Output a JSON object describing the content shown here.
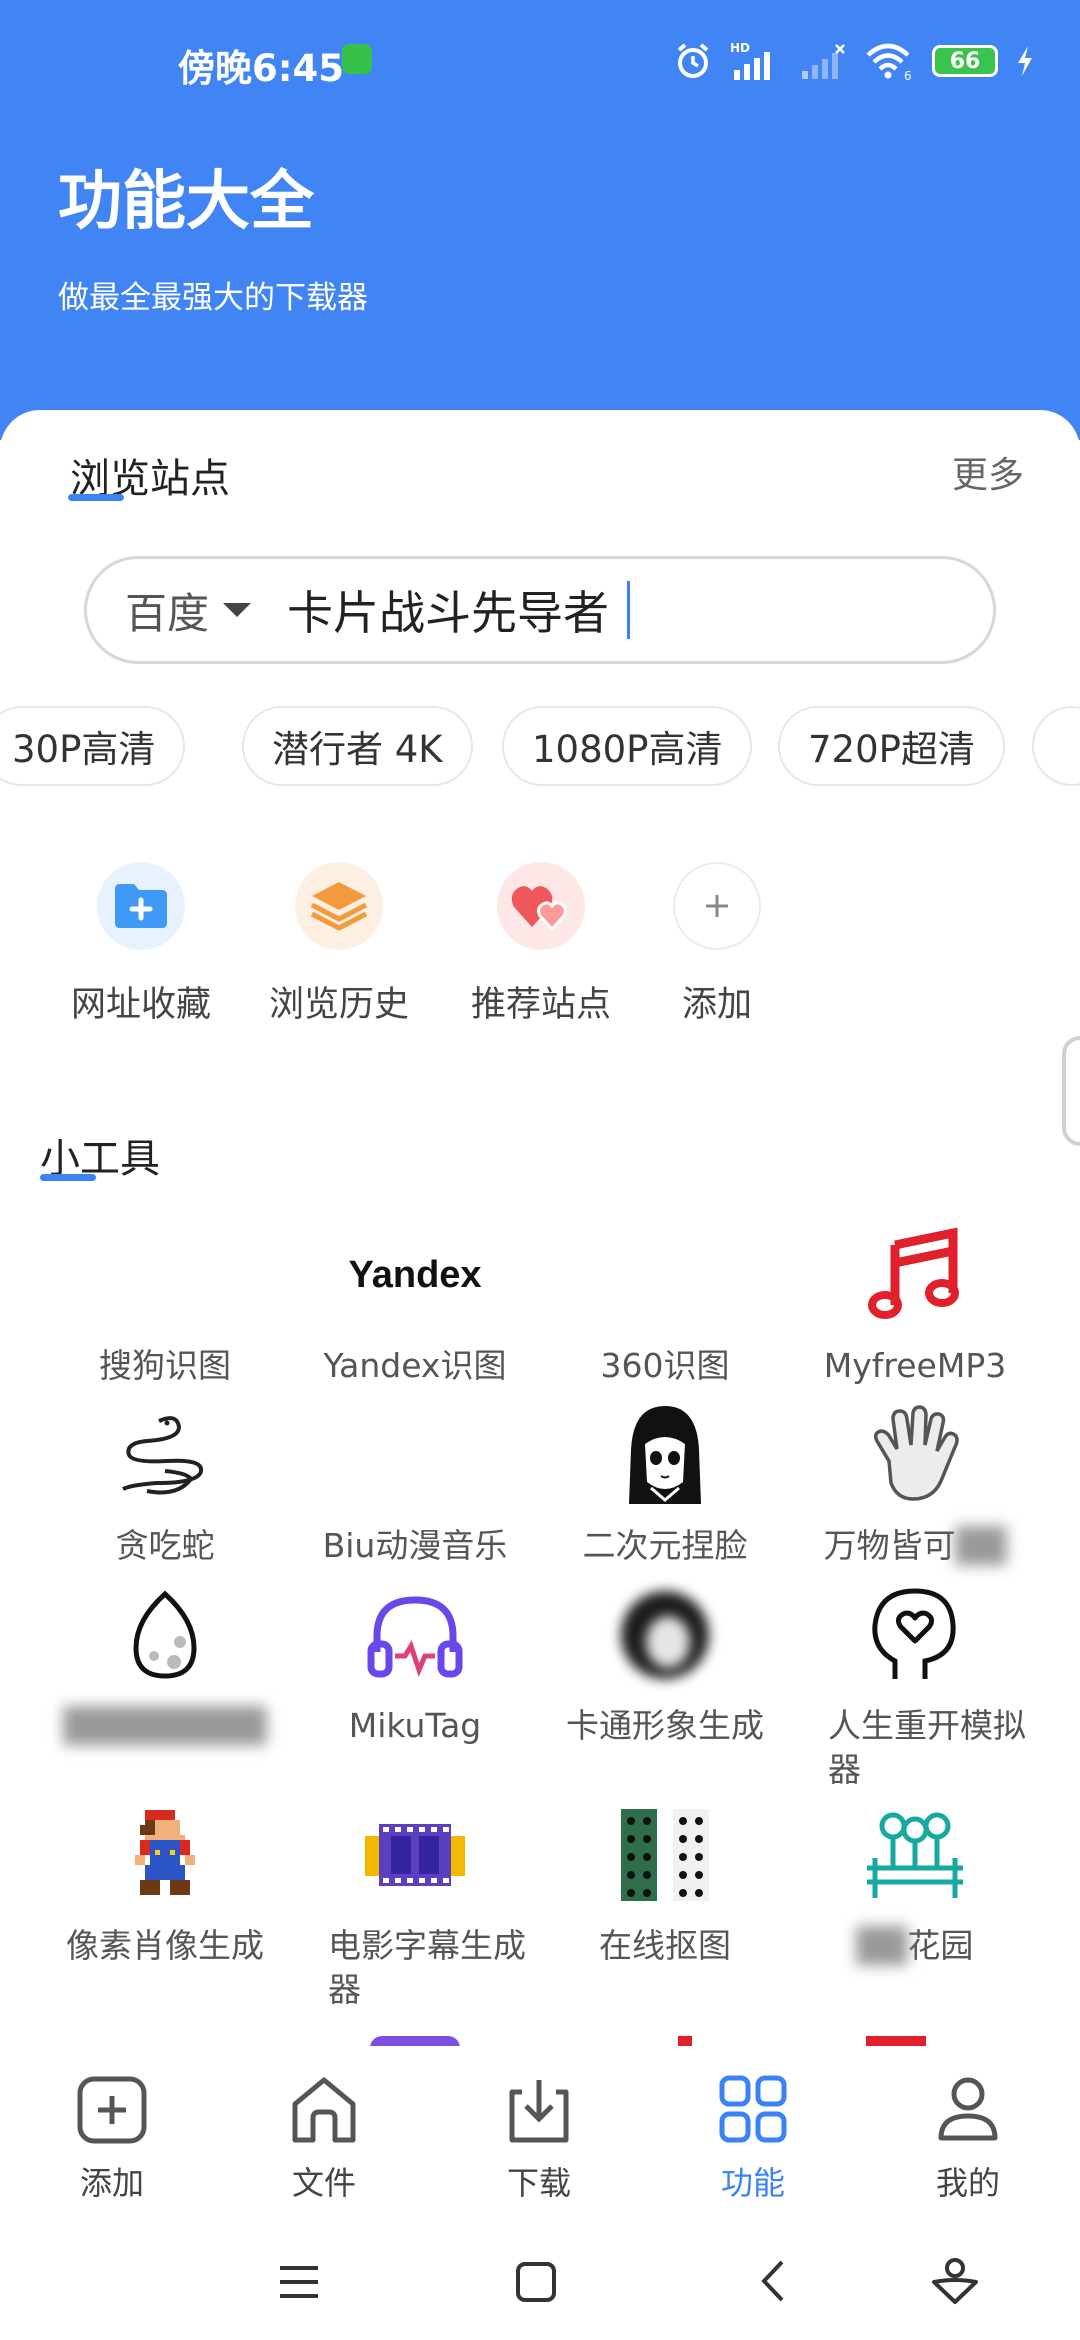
{
  "status_bar": {
    "time": "傍晚6:45",
    "network_badge": "HD",
    "network_type": "6",
    "battery": "66"
  },
  "header": {
    "title": "功能大全",
    "subtitle": "做最全最强大的下载器"
  },
  "browse": {
    "section_title": "浏览站点",
    "more": "更多",
    "engine": "百度",
    "query": "卡片战斗先导者",
    "chips": [
      "30P高清",
      "潜行者 4K",
      "1080P高清",
      "720P超清"
    ],
    "quick_links": [
      {
        "label": "网址收藏",
        "icon": "folder-plus-icon"
      },
      {
        "label": "浏览历史",
        "icon": "layers-icon"
      },
      {
        "label": "推荐站点",
        "icon": "hearts-icon"
      },
      {
        "label": "添加",
        "icon": "plus-icon"
      }
    ]
  },
  "tools": {
    "section_title": "小工具",
    "icon_text_yandex": "Yandex",
    "items": [
      {
        "label": "搜狗识图",
        "icon": "blank-icon"
      },
      {
        "label": "Yandex识图",
        "icon": "yandex-logo-icon"
      },
      {
        "label": "360识图",
        "icon": "blank-icon"
      },
      {
        "label": "MyfreeMP3",
        "icon": "music-note-icon"
      },
      {
        "label": "贪吃蛇",
        "icon": "snake-icon"
      },
      {
        "label": "Biu动漫音乐",
        "icon": "blank-icon"
      },
      {
        "label": "二次元捏脸",
        "icon": "anime-face-icon"
      },
      {
        "label": "万物皆可",
        "icon": "hand-icon"
      },
      {
        "label": "",
        "icon": "egg-icon"
      },
      {
        "label": "MikuTag",
        "icon": "headphones-icon"
      },
      {
        "label": "卡通形象生成",
        "icon": "blurred-avatar-icon"
      },
      {
        "label": "人生重开模拟器",
        "icon": "head-heart-icon"
      },
      {
        "label": "像素肖像生成",
        "icon": "pixel-mario-icon"
      },
      {
        "label": "电影字幕生成器",
        "icon": "film-strip-icon"
      },
      {
        "label": "在线抠图",
        "icon": "cutout-grid-icon"
      },
      {
        "label": "花园",
        "icon": "garden-icon"
      }
    ]
  },
  "bottom_nav": [
    {
      "label": "添加",
      "icon": "add-square-icon",
      "active": false
    },
    {
      "label": "文件",
      "icon": "home-icon",
      "active": false
    },
    {
      "label": "下载",
      "icon": "download-icon",
      "active": false
    },
    {
      "label": "功能",
      "icon": "grid-icon",
      "active": true
    },
    {
      "label": "我的",
      "icon": "person-icon",
      "active": false
    }
  ],
  "colors": {
    "brand": "#4184f3",
    "accent": "#3b82f6",
    "battery": "#3ac44f"
  }
}
